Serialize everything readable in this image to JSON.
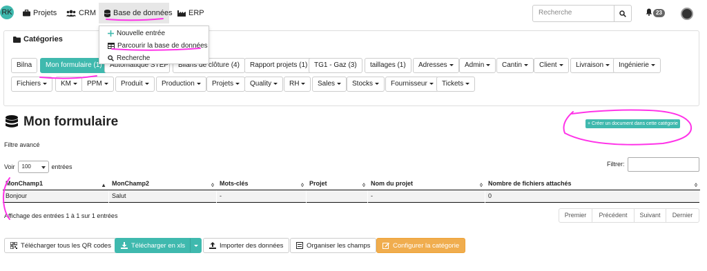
{
  "navbar": {
    "avatar_initials": "RK",
    "items": [
      {
        "label": "Projets",
        "icon": "briefcase-icon"
      },
      {
        "label": "CRM",
        "icon": "users-icon"
      },
      {
        "label": "Base de données",
        "icon": "database-icon"
      },
      {
        "label": "ERP",
        "icon": "industry-icon"
      }
    ],
    "search_placeholder": "Recherche",
    "notification_count": "23"
  },
  "dropdown": {
    "items": [
      {
        "label": "Nouvelle entrée",
        "icon": "plus-icon"
      },
      {
        "label": "Parcourir la base de données",
        "icon": "table-icon"
      },
      {
        "label": "Recherche",
        "icon": "search-icon"
      }
    ]
  },
  "categories": {
    "title": "Catégories",
    "row1": [
      {
        "label": "Bilna"
      },
      {
        "label": "Mon formulaire (1)"
      },
      {
        "label": "Automatique STEP"
      },
      {
        "label": "Bilans de clôture (4)"
      },
      {
        "label": "Rapport projets (1)"
      },
      {
        "label": "TG1 - Gaz (3)"
      },
      {
        "label": "taillages (1)"
      },
      {
        "label": "Adresses"
      },
      {
        "label": "Admin"
      },
      {
        "label": "Cantin"
      },
      {
        "label": "Client"
      },
      {
        "label": "Livraison"
      },
      {
        "label": "Ingénierie"
      }
    ],
    "row2": [
      {
        "label": "Fichiers"
      },
      {
        "label": "KM"
      },
      {
        "label": "PPM"
      },
      {
        "label": "Produit"
      },
      {
        "label": "Production"
      },
      {
        "label": "Projets"
      },
      {
        "label": "Quality"
      },
      {
        "label": "RH"
      },
      {
        "label": "Sales"
      },
      {
        "label": "Stocks"
      },
      {
        "label": "Fournisseur"
      },
      {
        "label": "Tickets"
      }
    ]
  },
  "page": {
    "title": "Mon formulaire",
    "create_label": "+ Créer un document dans cette catégorie",
    "advanced_filter": "Filtre avancé",
    "show_label": "Voir",
    "show_value": "100",
    "entries_label": "entrées",
    "filter_label": "Filtrer:"
  },
  "table": {
    "headers": [
      "MonChamp1",
      "MonChamp2",
      "Mots-clés",
      "Projet",
      "Nom du projet",
      "Nombre de fichiers attachés"
    ],
    "rows": [
      [
        "Bonjour",
        "Salut",
        "-",
        "",
        "-",
        "0"
      ]
    ]
  },
  "pagination": {
    "info": "Affichage des entrées 1 à 1 sur 1 entrées",
    "buttons": [
      "Premier",
      "Précédent",
      "Suivant",
      "Dernier"
    ]
  },
  "actions": {
    "qr": "Télécharger tous les QR codes",
    "xls": "Télécharger en xls",
    "import": "Importer des données",
    "organize": "Organiser les champs",
    "configure": "Configurer la catégorie"
  },
  "colors": {
    "accent": "#3fb9ae",
    "warning": "#f0ad4e",
    "annotation": "#ff33e8"
  }
}
